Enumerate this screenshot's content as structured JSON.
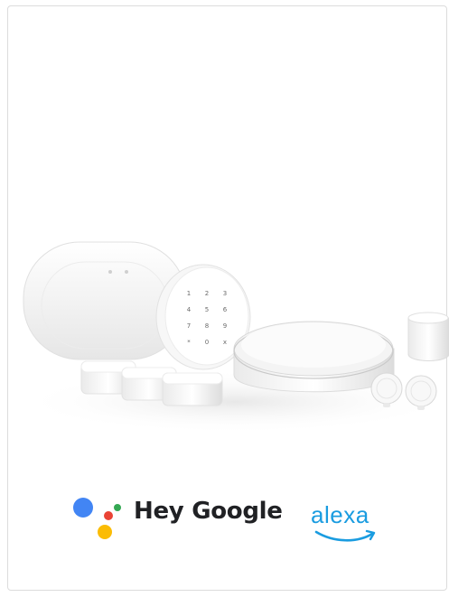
{
  "assistants": {
    "google_label": "Hey Google",
    "alexa_label": "alexa"
  },
  "colors": {
    "google_blue": "#4285F4",
    "google_red": "#EA4335",
    "google_yellow": "#FBBC05",
    "google_green": "#34A853",
    "alexa_blue": "#1a9ce0"
  },
  "keypad": {
    "keys": [
      "1",
      "2",
      "3",
      "4",
      "5",
      "6",
      "7",
      "8",
      "9",
      "*",
      "0",
      "x"
    ]
  }
}
